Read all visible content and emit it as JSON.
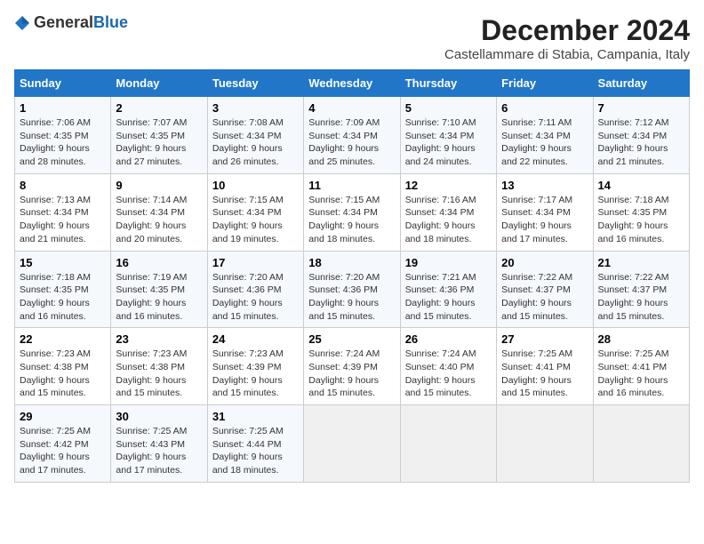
{
  "header": {
    "logo_general": "General",
    "logo_blue": "Blue",
    "title": "December 2024",
    "subtitle": "Castellammare di Stabia, Campania, Italy"
  },
  "columns": [
    "Sunday",
    "Monday",
    "Tuesday",
    "Wednesday",
    "Thursday",
    "Friday",
    "Saturday"
  ],
  "weeks": [
    [
      {
        "day": "1",
        "sunrise": "Sunrise: 7:06 AM",
        "sunset": "Sunset: 4:35 PM",
        "daylight": "Daylight: 9 hours and 28 minutes."
      },
      {
        "day": "2",
        "sunrise": "Sunrise: 7:07 AM",
        "sunset": "Sunset: 4:35 PM",
        "daylight": "Daylight: 9 hours and 27 minutes."
      },
      {
        "day": "3",
        "sunrise": "Sunrise: 7:08 AM",
        "sunset": "Sunset: 4:34 PM",
        "daylight": "Daylight: 9 hours and 26 minutes."
      },
      {
        "day": "4",
        "sunrise": "Sunrise: 7:09 AM",
        "sunset": "Sunset: 4:34 PM",
        "daylight": "Daylight: 9 hours and 25 minutes."
      },
      {
        "day": "5",
        "sunrise": "Sunrise: 7:10 AM",
        "sunset": "Sunset: 4:34 PM",
        "daylight": "Daylight: 9 hours and 24 minutes."
      },
      {
        "day": "6",
        "sunrise": "Sunrise: 7:11 AM",
        "sunset": "Sunset: 4:34 PM",
        "daylight": "Daylight: 9 hours and 22 minutes."
      },
      {
        "day": "7",
        "sunrise": "Sunrise: 7:12 AM",
        "sunset": "Sunset: 4:34 PM",
        "daylight": "Daylight: 9 hours and 21 minutes."
      }
    ],
    [
      {
        "day": "8",
        "sunrise": "Sunrise: 7:13 AM",
        "sunset": "Sunset: 4:34 PM",
        "daylight": "Daylight: 9 hours and 21 minutes."
      },
      {
        "day": "9",
        "sunrise": "Sunrise: 7:14 AM",
        "sunset": "Sunset: 4:34 PM",
        "daylight": "Daylight: 9 hours and 20 minutes."
      },
      {
        "day": "10",
        "sunrise": "Sunrise: 7:15 AM",
        "sunset": "Sunset: 4:34 PM",
        "daylight": "Daylight: 9 hours and 19 minutes."
      },
      {
        "day": "11",
        "sunrise": "Sunrise: 7:15 AM",
        "sunset": "Sunset: 4:34 PM",
        "daylight": "Daylight: 9 hours and 18 minutes."
      },
      {
        "day": "12",
        "sunrise": "Sunrise: 7:16 AM",
        "sunset": "Sunset: 4:34 PM",
        "daylight": "Daylight: 9 hours and 18 minutes."
      },
      {
        "day": "13",
        "sunrise": "Sunrise: 7:17 AM",
        "sunset": "Sunset: 4:34 PM",
        "daylight": "Daylight: 9 hours and 17 minutes."
      },
      {
        "day": "14",
        "sunrise": "Sunrise: 7:18 AM",
        "sunset": "Sunset: 4:35 PM",
        "daylight": "Daylight: 9 hours and 16 minutes."
      }
    ],
    [
      {
        "day": "15",
        "sunrise": "Sunrise: 7:18 AM",
        "sunset": "Sunset: 4:35 PM",
        "daylight": "Daylight: 9 hours and 16 minutes."
      },
      {
        "day": "16",
        "sunrise": "Sunrise: 7:19 AM",
        "sunset": "Sunset: 4:35 PM",
        "daylight": "Daylight: 9 hours and 16 minutes."
      },
      {
        "day": "17",
        "sunrise": "Sunrise: 7:20 AM",
        "sunset": "Sunset: 4:36 PM",
        "daylight": "Daylight: 9 hours and 15 minutes."
      },
      {
        "day": "18",
        "sunrise": "Sunrise: 7:20 AM",
        "sunset": "Sunset: 4:36 PM",
        "daylight": "Daylight: 9 hours and 15 minutes."
      },
      {
        "day": "19",
        "sunrise": "Sunrise: 7:21 AM",
        "sunset": "Sunset: 4:36 PM",
        "daylight": "Daylight: 9 hours and 15 minutes."
      },
      {
        "day": "20",
        "sunrise": "Sunrise: 7:22 AM",
        "sunset": "Sunset: 4:37 PM",
        "daylight": "Daylight: 9 hours and 15 minutes."
      },
      {
        "day": "21",
        "sunrise": "Sunrise: 7:22 AM",
        "sunset": "Sunset: 4:37 PM",
        "daylight": "Daylight: 9 hours and 15 minutes."
      }
    ],
    [
      {
        "day": "22",
        "sunrise": "Sunrise: 7:23 AM",
        "sunset": "Sunset: 4:38 PM",
        "daylight": "Daylight: 9 hours and 15 minutes."
      },
      {
        "day": "23",
        "sunrise": "Sunrise: 7:23 AM",
        "sunset": "Sunset: 4:38 PM",
        "daylight": "Daylight: 9 hours and 15 minutes."
      },
      {
        "day": "24",
        "sunrise": "Sunrise: 7:23 AM",
        "sunset": "Sunset: 4:39 PM",
        "daylight": "Daylight: 9 hours and 15 minutes."
      },
      {
        "day": "25",
        "sunrise": "Sunrise: 7:24 AM",
        "sunset": "Sunset: 4:39 PM",
        "daylight": "Daylight: 9 hours and 15 minutes."
      },
      {
        "day": "26",
        "sunrise": "Sunrise: 7:24 AM",
        "sunset": "Sunset: 4:40 PM",
        "daylight": "Daylight: 9 hours and 15 minutes."
      },
      {
        "day": "27",
        "sunrise": "Sunrise: 7:25 AM",
        "sunset": "Sunset: 4:41 PM",
        "daylight": "Daylight: 9 hours and 15 minutes."
      },
      {
        "day": "28",
        "sunrise": "Sunrise: 7:25 AM",
        "sunset": "Sunset: 4:41 PM",
        "daylight": "Daylight: 9 hours and 16 minutes."
      }
    ],
    [
      {
        "day": "29",
        "sunrise": "Sunrise: 7:25 AM",
        "sunset": "Sunset: 4:42 PM",
        "daylight": "Daylight: 9 hours and 17 minutes."
      },
      {
        "day": "30",
        "sunrise": "Sunrise: 7:25 AM",
        "sunset": "Sunset: 4:43 PM",
        "daylight": "Daylight: 9 hours and 17 minutes."
      },
      {
        "day": "31",
        "sunrise": "Sunrise: 7:25 AM",
        "sunset": "Sunset: 4:44 PM",
        "daylight": "Daylight: 9 hours and 18 minutes."
      },
      null,
      null,
      null,
      null
    ]
  ]
}
